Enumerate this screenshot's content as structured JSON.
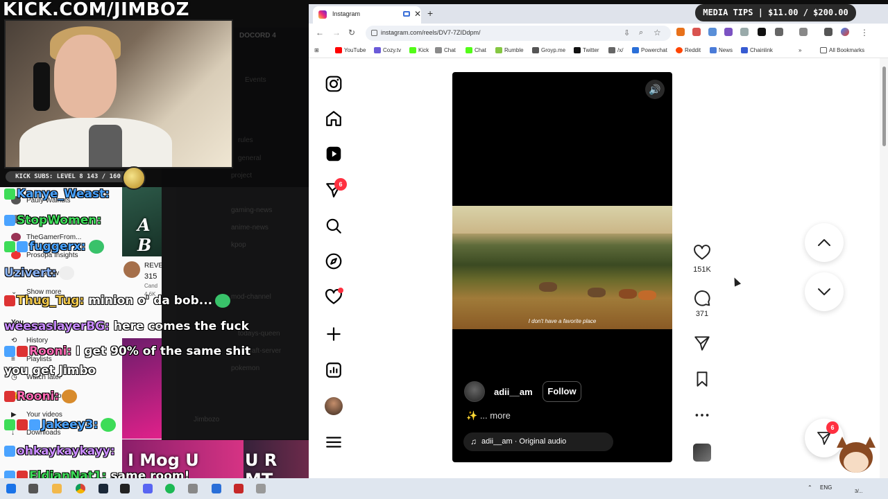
{
  "overlay": {
    "brand": "KICK.COM/JIMBOZ",
    "subs_text": "KICK SUBS: LEVEL 8 143 / 160",
    "media_tips": "MEDIA TIPS | $11.00 / $200.00"
  },
  "youtube_sidebar": {
    "items": [
      "Pauly Walnuts",
      "R... H...",
      "TheGamerFrom...",
      "Prosopa Insights",
      "Show all",
      "Show more",
      "You",
      "History",
      "Playlists",
      "Watch later",
      "Liked videos",
      "Your videos",
      "Downloads"
    ],
    "channel_name": "REVE",
    "channel_num": "315",
    "channel_sub1": "Cand",
    "channel_sub2": "4.6K",
    "thumb_text_1": "A B",
    "thumb_text_2": "I Mog U",
    "thumb_text_3": "U R MT"
  },
  "chat": [
    {
      "user": "Kanye_Weast:",
      "msg": "",
      "color": "#4aa3ff"
    },
    {
      "user": "StopWomen:",
      "msg": "",
      "color": "#3ddc58"
    },
    {
      "user": "fuggerx:",
      "msg": "",
      "color": "#4aa3ff"
    },
    {
      "user": "Uzivert:",
      "msg": "",
      "color": "#8ab4f8"
    },
    {
      "user": "Thug_Tug:",
      "msg": "minion o' da bob...",
      "color": "#f2c94c"
    },
    {
      "user": "weesaslayerBG:",
      "msg": "here comes the fuck",
      "color": "#c98bff"
    },
    {
      "user": "Rooni:",
      "msg": "I get 90% of the same shit",
      "color": "#ff69b4"
    },
    {
      "user": "",
      "msg": "you get Jimbo",
      "color": "#ffffff"
    },
    {
      "user": "Rooni:",
      "msg": "",
      "color": "#ff69b4"
    },
    {
      "user": "Jakeey3:",
      "msg": "",
      "color": "#4aa3ff"
    },
    {
      "user": "ohkaykaykayy:",
      "msg": "",
      "color": "#c98bff"
    },
    {
      "user": "EldianNat1:",
      "msg": "same room!",
      "color": "#3ddc58"
    }
  ],
  "discord": {
    "channels": [
      "DOCORD 4",
      "Events",
      "rules",
      "general",
      "memes",
      "project",
      "gaming-news",
      "anime-news",
      "kpop",
      "politics",
      "bot-channel",
      "mod-channel",
      "todays-queen",
      "minecraft-server",
      "pokemon",
      "Jimbozo"
    ]
  },
  "browser": {
    "tab_title": "Instagram",
    "url": "instagram.com/reels/DV7-7ZIDdpm/",
    "bookmarks": [
      "YouTube",
      "Cozy.tv",
      "Kick",
      "Chat",
      "Chat",
      "Rumble",
      "Groyp.me",
      "Twitter",
      "/x/",
      "Powerchat",
      "Reddit",
      "News",
      "Chainlink"
    ],
    "all_bookmarks": "All Bookmarks",
    "right_edge": "rks"
  },
  "instagram": {
    "notification_count": "6",
    "reel": {
      "caption": "I don't have a favorite place",
      "username": "adii__am",
      "follow_label": "Follow",
      "more_text": "... more",
      "sparkle": "✨",
      "audio": "adii__am · Original audio"
    },
    "likes": "151K",
    "comments": "371",
    "share_badge": "6"
  },
  "taskbar": {
    "lang": "ENG",
    "date": "3/..."
  },
  "colors": {
    "accent_red": "#ff3040",
    "ig_text": "#262626"
  }
}
